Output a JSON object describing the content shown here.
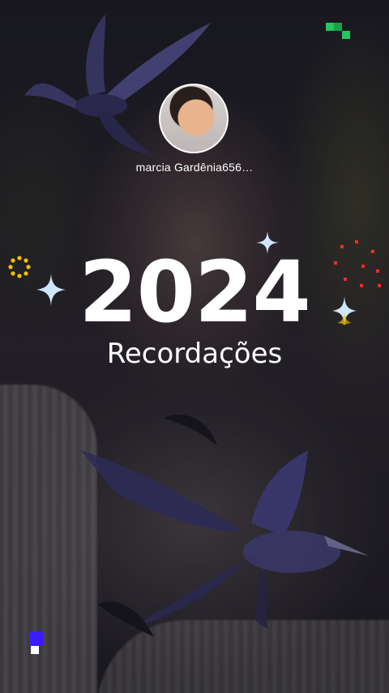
{
  "profile": {
    "username": "marcia Gardênia656…"
  },
  "memories": {
    "year": "2024",
    "title": "Recordações"
  },
  "colors": {
    "sparkle": "#cfe6ff",
    "pixel_green": "#22c55e",
    "pixel_purple": "#3b1cff",
    "dots_red": "#ff2a2a",
    "ring_yellow": "#f3c100"
  }
}
